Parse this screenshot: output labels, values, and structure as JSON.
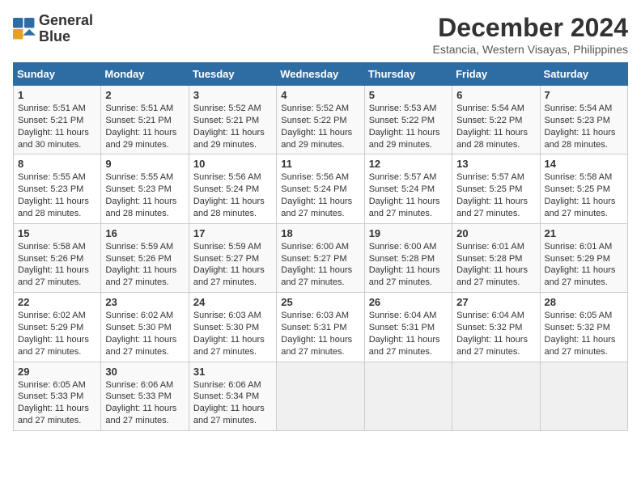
{
  "header": {
    "logo_line1": "General",
    "logo_line2": "Blue",
    "month_year": "December 2024",
    "location": "Estancia, Western Visayas, Philippines"
  },
  "weekdays": [
    "Sunday",
    "Monday",
    "Tuesday",
    "Wednesday",
    "Thursday",
    "Friday",
    "Saturday"
  ],
  "weeks": [
    [
      {
        "day": "1",
        "rise": "Sunrise: 5:51 AM",
        "set": "Sunset: 5:21 PM",
        "daylight": "Daylight: 11 hours and 30 minutes."
      },
      {
        "day": "2",
        "rise": "Sunrise: 5:51 AM",
        "set": "Sunset: 5:21 PM",
        "daylight": "Daylight: 11 hours and 29 minutes."
      },
      {
        "day": "3",
        "rise": "Sunrise: 5:52 AM",
        "set": "Sunset: 5:21 PM",
        "daylight": "Daylight: 11 hours and 29 minutes."
      },
      {
        "day": "4",
        "rise": "Sunrise: 5:52 AM",
        "set": "Sunset: 5:22 PM",
        "daylight": "Daylight: 11 hours and 29 minutes."
      },
      {
        "day": "5",
        "rise": "Sunrise: 5:53 AM",
        "set": "Sunset: 5:22 PM",
        "daylight": "Daylight: 11 hours and 29 minutes."
      },
      {
        "day": "6",
        "rise": "Sunrise: 5:54 AM",
        "set": "Sunset: 5:22 PM",
        "daylight": "Daylight: 11 hours and 28 minutes."
      },
      {
        "day": "7",
        "rise": "Sunrise: 5:54 AM",
        "set": "Sunset: 5:23 PM",
        "daylight": "Daylight: 11 hours and 28 minutes."
      }
    ],
    [
      {
        "day": "8",
        "rise": "Sunrise: 5:55 AM",
        "set": "Sunset: 5:23 PM",
        "daylight": "Daylight: 11 hours and 28 minutes."
      },
      {
        "day": "9",
        "rise": "Sunrise: 5:55 AM",
        "set": "Sunset: 5:23 PM",
        "daylight": "Daylight: 11 hours and 28 minutes."
      },
      {
        "day": "10",
        "rise": "Sunrise: 5:56 AM",
        "set": "Sunset: 5:24 PM",
        "daylight": "Daylight: 11 hours and 28 minutes."
      },
      {
        "day": "11",
        "rise": "Sunrise: 5:56 AM",
        "set": "Sunset: 5:24 PM",
        "daylight": "Daylight: 11 hours and 27 minutes."
      },
      {
        "day": "12",
        "rise": "Sunrise: 5:57 AM",
        "set": "Sunset: 5:24 PM",
        "daylight": "Daylight: 11 hours and 27 minutes."
      },
      {
        "day": "13",
        "rise": "Sunrise: 5:57 AM",
        "set": "Sunset: 5:25 PM",
        "daylight": "Daylight: 11 hours and 27 minutes."
      },
      {
        "day": "14",
        "rise": "Sunrise: 5:58 AM",
        "set": "Sunset: 5:25 PM",
        "daylight": "Daylight: 11 hours and 27 minutes."
      }
    ],
    [
      {
        "day": "15",
        "rise": "Sunrise: 5:58 AM",
        "set": "Sunset: 5:26 PM",
        "daylight": "Daylight: 11 hours and 27 minutes."
      },
      {
        "day": "16",
        "rise": "Sunrise: 5:59 AM",
        "set": "Sunset: 5:26 PM",
        "daylight": "Daylight: 11 hours and 27 minutes."
      },
      {
        "day": "17",
        "rise": "Sunrise: 5:59 AM",
        "set": "Sunset: 5:27 PM",
        "daylight": "Daylight: 11 hours and 27 minutes."
      },
      {
        "day": "18",
        "rise": "Sunrise: 6:00 AM",
        "set": "Sunset: 5:27 PM",
        "daylight": "Daylight: 11 hours and 27 minutes."
      },
      {
        "day": "19",
        "rise": "Sunrise: 6:00 AM",
        "set": "Sunset: 5:28 PM",
        "daylight": "Daylight: 11 hours and 27 minutes."
      },
      {
        "day": "20",
        "rise": "Sunrise: 6:01 AM",
        "set": "Sunset: 5:28 PM",
        "daylight": "Daylight: 11 hours and 27 minutes."
      },
      {
        "day": "21",
        "rise": "Sunrise: 6:01 AM",
        "set": "Sunset: 5:29 PM",
        "daylight": "Daylight: 11 hours and 27 minutes."
      }
    ],
    [
      {
        "day": "22",
        "rise": "Sunrise: 6:02 AM",
        "set": "Sunset: 5:29 PM",
        "daylight": "Daylight: 11 hours and 27 minutes."
      },
      {
        "day": "23",
        "rise": "Sunrise: 6:02 AM",
        "set": "Sunset: 5:30 PM",
        "daylight": "Daylight: 11 hours and 27 minutes."
      },
      {
        "day": "24",
        "rise": "Sunrise: 6:03 AM",
        "set": "Sunset: 5:30 PM",
        "daylight": "Daylight: 11 hours and 27 minutes."
      },
      {
        "day": "25",
        "rise": "Sunrise: 6:03 AM",
        "set": "Sunset: 5:31 PM",
        "daylight": "Daylight: 11 hours and 27 minutes."
      },
      {
        "day": "26",
        "rise": "Sunrise: 6:04 AM",
        "set": "Sunset: 5:31 PM",
        "daylight": "Daylight: 11 hours and 27 minutes."
      },
      {
        "day": "27",
        "rise": "Sunrise: 6:04 AM",
        "set": "Sunset: 5:32 PM",
        "daylight": "Daylight: 11 hours and 27 minutes."
      },
      {
        "day": "28",
        "rise": "Sunrise: 6:05 AM",
        "set": "Sunset: 5:32 PM",
        "daylight": "Daylight: 11 hours and 27 minutes."
      }
    ],
    [
      {
        "day": "29",
        "rise": "Sunrise: 6:05 AM",
        "set": "Sunset: 5:33 PM",
        "daylight": "Daylight: 11 hours and 27 minutes."
      },
      {
        "day": "30",
        "rise": "Sunrise: 6:06 AM",
        "set": "Sunset: 5:33 PM",
        "daylight": "Daylight: 11 hours and 27 minutes."
      },
      {
        "day": "31",
        "rise": "Sunrise: 6:06 AM",
        "set": "Sunset: 5:34 PM",
        "daylight": "Daylight: 11 hours and 27 minutes."
      },
      null,
      null,
      null,
      null
    ]
  ]
}
